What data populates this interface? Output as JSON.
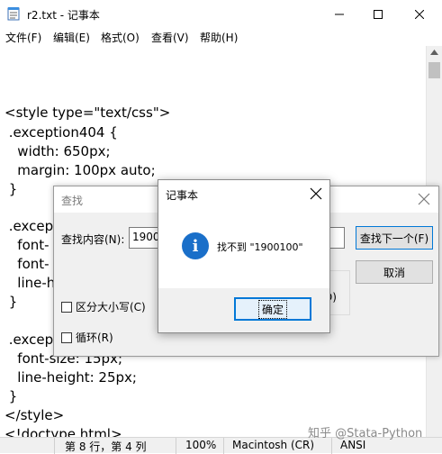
{
  "window": {
    "title": "r2.txt - 记事本",
    "minimize_symbol": "—",
    "maximize_symbol": "☐",
    "close_symbol": "✕"
  },
  "menu": {
    "items": [
      "文件(F)",
      "编辑(E)",
      "格式(O)",
      "查看(V)",
      "帮助(H)"
    ]
  },
  "editor": {
    "lines": [
      "<style type=\"text/css\">",
      " .exception404 {",
      "   width: 650px;",
      "   margin: 100px auto;",
      " }",
      "",
      " .excep",
      "   font-",
      "   font-",
      "   line-h",
      " }",
      "",
      " .excep",
      "   font-size: 15px;",
      "   line-height: 25px;",
      " }",
      "</style>",
      "<!doctype html>"
    ]
  },
  "statusbar": {
    "position": "第 8 行，第 4 列",
    "zoom": "100%",
    "line_ending": "Macintosh (CR)",
    "encoding": "ANSI"
  },
  "watermark": "知乎 @Stata-Python",
  "find_dialog": {
    "title": "查找",
    "find_label": "查找内容(N):",
    "find_value": "1900",
    "find_next_button": "查找下一个(F)",
    "cancel_button": "取消",
    "direction_fragment": "D)",
    "match_case_label": "区分大小写(C)",
    "wrap_label": "循环(R)"
  },
  "message_box": {
    "title": "记事本",
    "message": "找不到 \"1900100\"",
    "ok_button": "确定",
    "icon": "info-icon"
  }
}
